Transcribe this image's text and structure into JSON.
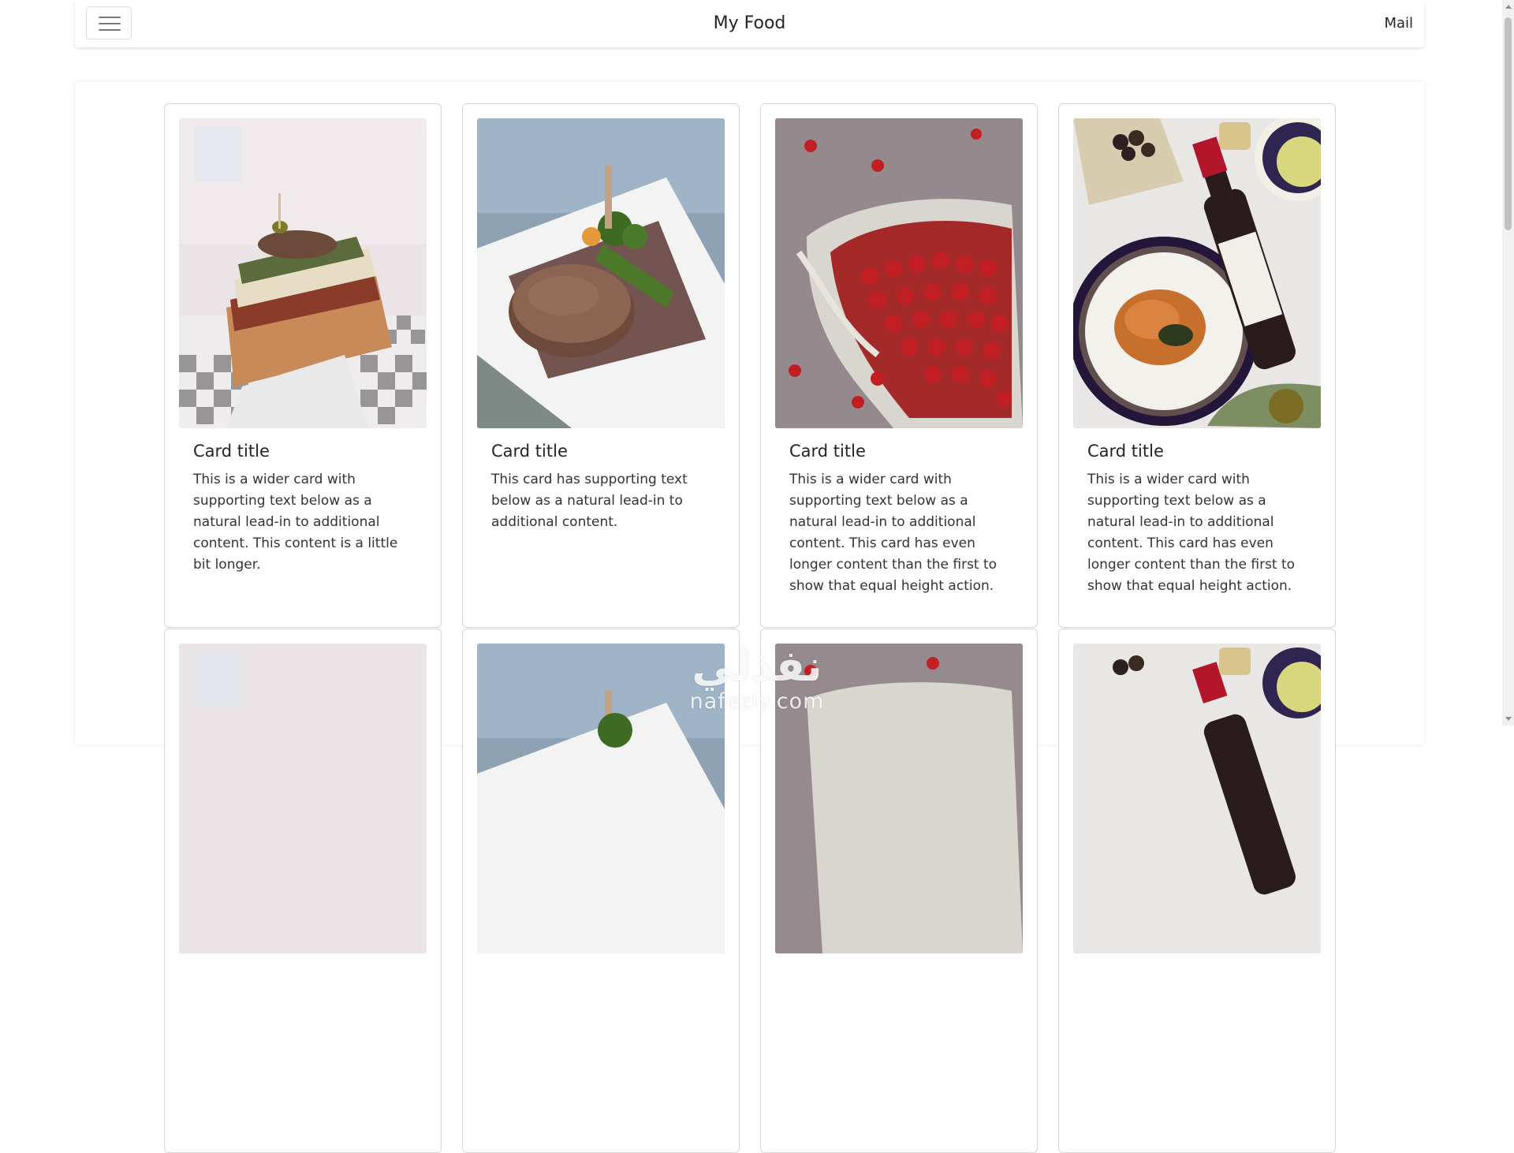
{
  "navbar": {
    "brand": "My Food",
    "mail_label": "Mail",
    "menu_icon": "hamburger-menu-icon"
  },
  "cards": [
    {
      "image": "sandwich-photo",
      "title": "Card title",
      "text": "This is a wider card with supporting text below as a natural lead-in to additional content. This content is a little bit longer."
    },
    {
      "image": "steak-photo",
      "title": "Card title",
      "text": "This card has supporting text below as a natural lead-in to additional content."
    },
    {
      "image": "cherries-photo",
      "title": "Card title",
      "text": "This is a wider card with supporting text below as a natural lead-in to additional content. This card has even longer content than the first to show that equal height action."
    },
    {
      "image": "pasta-wine-photo",
      "title": "Card title",
      "text": "This is a wider card with supporting text below as a natural lead-in to additional content. This card has even longer content than the first to show that equal height action."
    }
  ],
  "second_row_images": [
    "sandwich-photo",
    "steak-photo",
    "cherries-photo",
    "pasta-wine-photo"
  ],
  "watermark": {
    "arabic": "نفذلي",
    "latin": "nafezly.com"
  },
  "colors": {
    "card_border": "#d6d6d6",
    "text": "#212529",
    "page_bg": "#ffffff"
  }
}
